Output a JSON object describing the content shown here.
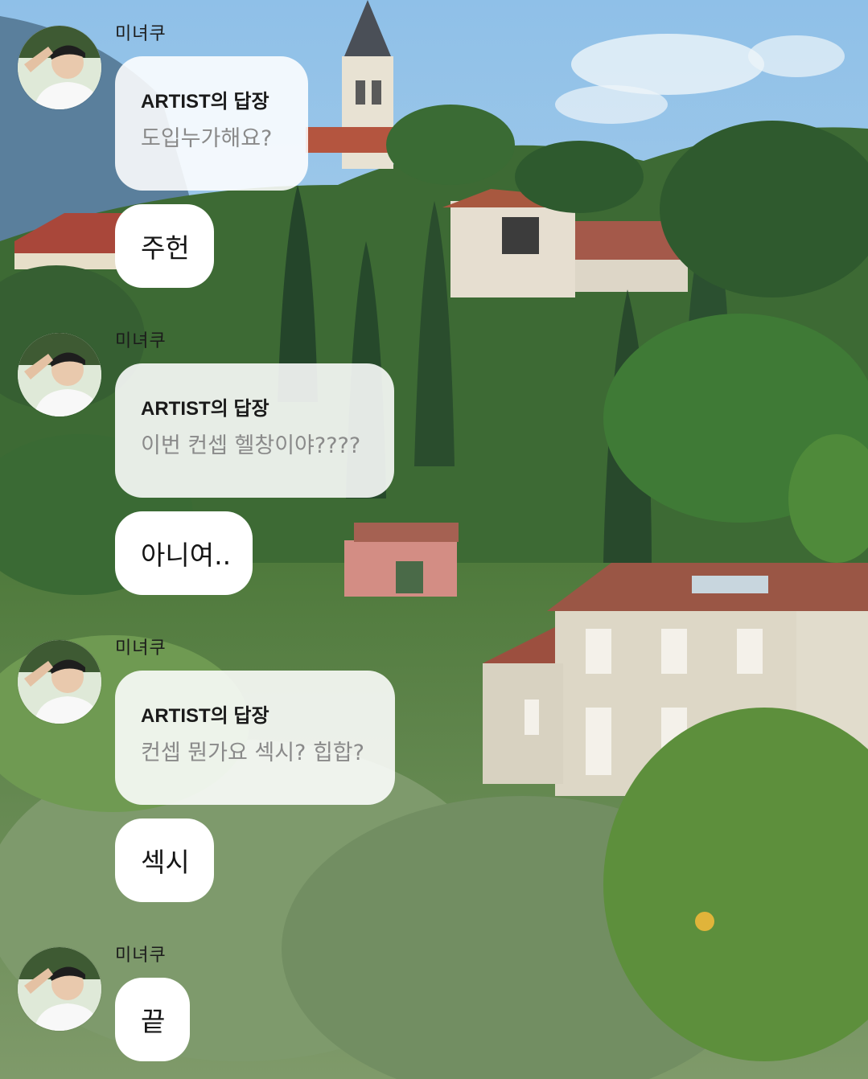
{
  "chat": {
    "sender_name": "미녀쿠",
    "reply_label": "ARTIST의 답장",
    "groups": [
      {
        "sender": "미녀쿠",
        "reply_label": "ARTIST의 답장",
        "reply_text": "도입누가해요?",
        "message": "주헌"
      },
      {
        "sender": "미녀쿠",
        "reply_label": "ARTIST의 답장",
        "reply_text": "이번 컨셉 헬창이야????",
        "message": "아니여.."
      },
      {
        "sender": "미녀쿠",
        "reply_label": "ARTIST의 답장",
        "reply_text": "컨셉 뭔가요 섹시? 힙합?",
        "message": "섹시"
      },
      {
        "sender": "미녀쿠",
        "message": "끝"
      }
    ]
  },
  "colors": {
    "sky": "#9cc6e6",
    "foliage_dark": "#2f5a2e",
    "foliage_light": "#7fa55a",
    "roof": "#a55a45",
    "wall": "#e6e0d2",
    "bubble_white": "#ffffff",
    "reply_text_gray": "#8a8a8a"
  }
}
